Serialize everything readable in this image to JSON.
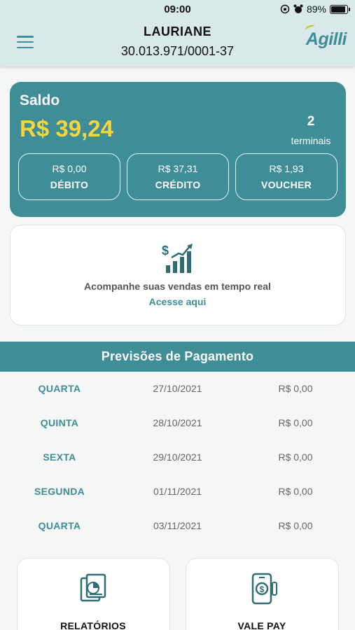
{
  "status_bar": {
    "time": "09:00",
    "battery": "89%",
    "battery_level": 0.89
  },
  "header": {
    "name": "LAURIANE",
    "document": "30.013.971/0001-37",
    "logo_text": "Agilli"
  },
  "balance": {
    "label": "Saldo",
    "amount": "R$ 39,24",
    "terminals_count": "2",
    "terminals_label": "terminais",
    "breakdown": [
      {
        "value": "R$ 0,00",
        "type": "DÉBITO"
      },
      {
        "value": "R$ 37,31",
        "type": "CRÉDITO"
      },
      {
        "value": "R$ 1,93",
        "type": "VOUCHER"
      }
    ]
  },
  "realtime": {
    "description": "Acompanhe suas vendas em tempo real",
    "link": "Acesse aqui"
  },
  "forecast": {
    "title": "Previsões de Pagamento",
    "rows": [
      {
        "day": "QUARTA",
        "date": "27/10/2021",
        "value": "R$ 0,00"
      },
      {
        "day": "QUINTA",
        "date": "28/10/2021",
        "value": "R$ 0,00"
      },
      {
        "day": "SEXTA",
        "date": "29/10/2021",
        "value": "R$ 0,00"
      },
      {
        "day": "SEGUNDA",
        "date": "01/11/2021",
        "value": "R$ 0,00"
      },
      {
        "day": "QUARTA",
        "date": "03/11/2021",
        "value": "R$ 0,00"
      }
    ]
  },
  "tiles": [
    {
      "label": "RELATÓRIOS",
      "icon": "reports-icon"
    },
    {
      "label": "VALE PAY",
      "icon": "phone-payment-icon"
    }
  ],
  "colors": {
    "accent": "#3e8d97",
    "header_bg": "#d9e9ea",
    "amount": "#f5d43c"
  }
}
